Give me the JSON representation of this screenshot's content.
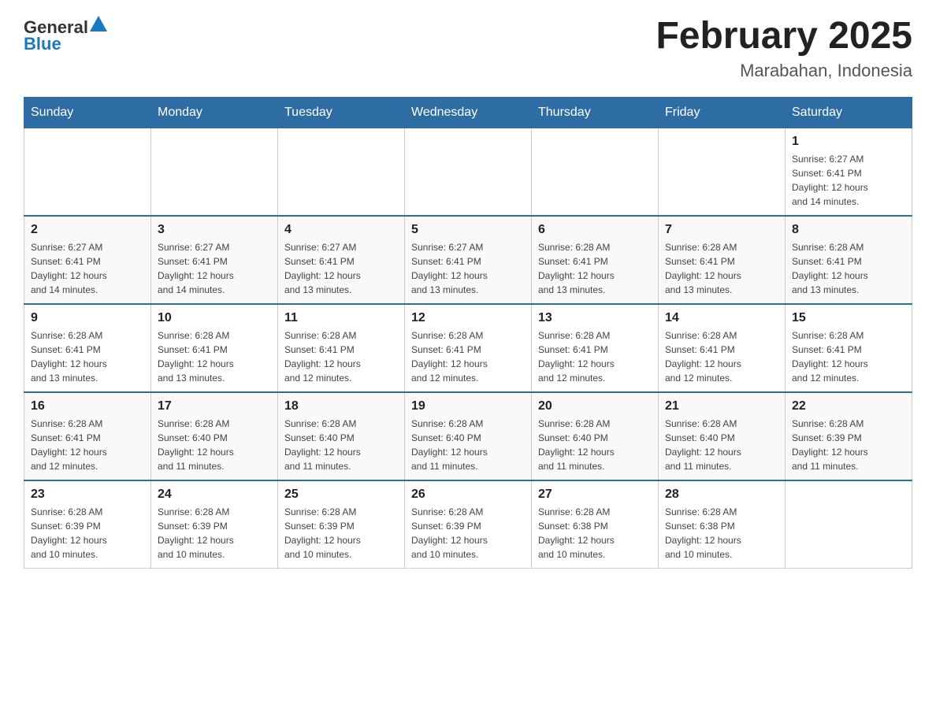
{
  "header": {
    "logo_general": "General",
    "logo_blue": "Blue",
    "title": "February 2025",
    "subtitle": "Marabahan, Indonesia"
  },
  "days_of_week": [
    "Sunday",
    "Monday",
    "Tuesday",
    "Wednesday",
    "Thursday",
    "Friday",
    "Saturday"
  ],
  "weeks": [
    [
      {
        "day": "",
        "info": ""
      },
      {
        "day": "",
        "info": ""
      },
      {
        "day": "",
        "info": ""
      },
      {
        "day": "",
        "info": ""
      },
      {
        "day": "",
        "info": ""
      },
      {
        "day": "",
        "info": ""
      },
      {
        "day": "1",
        "info": "Sunrise: 6:27 AM\nSunset: 6:41 PM\nDaylight: 12 hours\nand 14 minutes."
      }
    ],
    [
      {
        "day": "2",
        "info": "Sunrise: 6:27 AM\nSunset: 6:41 PM\nDaylight: 12 hours\nand 14 minutes."
      },
      {
        "day": "3",
        "info": "Sunrise: 6:27 AM\nSunset: 6:41 PM\nDaylight: 12 hours\nand 14 minutes."
      },
      {
        "day": "4",
        "info": "Sunrise: 6:27 AM\nSunset: 6:41 PM\nDaylight: 12 hours\nand 13 minutes."
      },
      {
        "day": "5",
        "info": "Sunrise: 6:27 AM\nSunset: 6:41 PM\nDaylight: 12 hours\nand 13 minutes."
      },
      {
        "day": "6",
        "info": "Sunrise: 6:28 AM\nSunset: 6:41 PM\nDaylight: 12 hours\nand 13 minutes."
      },
      {
        "day": "7",
        "info": "Sunrise: 6:28 AM\nSunset: 6:41 PM\nDaylight: 12 hours\nand 13 minutes."
      },
      {
        "day": "8",
        "info": "Sunrise: 6:28 AM\nSunset: 6:41 PM\nDaylight: 12 hours\nand 13 minutes."
      }
    ],
    [
      {
        "day": "9",
        "info": "Sunrise: 6:28 AM\nSunset: 6:41 PM\nDaylight: 12 hours\nand 13 minutes."
      },
      {
        "day": "10",
        "info": "Sunrise: 6:28 AM\nSunset: 6:41 PM\nDaylight: 12 hours\nand 13 minutes."
      },
      {
        "day": "11",
        "info": "Sunrise: 6:28 AM\nSunset: 6:41 PM\nDaylight: 12 hours\nand 12 minutes."
      },
      {
        "day": "12",
        "info": "Sunrise: 6:28 AM\nSunset: 6:41 PM\nDaylight: 12 hours\nand 12 minutes."
      },
      {
        "day": "13",
        "info": "Sunrise: 6:28 AM\nSunset: 6:41 PM\nDaylight: 12 hours\nand 12 minutes."
      },
      {
        "day": "14",
        "info": "Sunrise: 6:28 AM\nSunset: 6:41 PM\nDaylight: 12 hours\nand 12 minutes."
      },
      {
        "day": "15",
        "info": "Sunrise: 6:28 AM\nSunset: 6:41 PM\nDaylight: 12 hours\nand 12 minutes."
      }
    ],
    [
      {
        "day": "16",
        "info": "Sunrise: 6:28 AM\nSunset: 6:41 PM\nDaylight: 12 hours\nand 12 minutes."
      },
      {
        "day": "17",
        "info": "Sunrise: 6:28 AM\nSunset: 6:40 PM\nDaylight: 12 hours\nand 11 minutes."
      },
      {
        "day": "18",
        "info": "Sunrise: 6:28 AM\nSunset: 6:40 PM\nDaylight: 12 hours\nand 11 minutes."
      },
      {
        "day": "19",
        "info": "Sunrise: 6:28 AM\nSunset: 6:40 PM\nDaylight: 12 hours\nand 11 minutes."
      },
      {
        "day": "20",
        "info": "Sunrise: 6:28 AM\nSunset: 6:40 PM\nDaylight: 12 hours\nand 11 minutes."
      },
      {
        "day": "21",
        "info": "Sunrise: 6:28 AM\nSunset: 6:40 PM\nDaylight: 12 hours\nand 11 minutes."
      },
      {
        "day": "22",
        "info": "Sunrise: 6:28 AM\nSunset: 6:39 PM\nDaylight: 12 hours\nand 11 minutes."
      }
    ],
    [
      {
        "day": "23",
        "info": "Sunrise: 6:28 AM\nSunset: 6:39 PM\nDaylight: 12 hours\nand 10 minutes."
      },
      {
        "day": "24",
        "info": "Sunrise: 6:28 AM\nSunset: 6:39 PM\nDaylight: 12 hours\nand 10 minutes."
      },
      {
        "day": "25",
        "info": "Sunrise: 6:28 AM\nSunset: 6:39 PM\nDaylight: 12 hours\nand 10 minutes."
      },
      {
        "day": "26",
        "info": "Sunrise: 6:28 AM\nSunset: 6:39 PM\nDaylight: 12 hours\nand 10 minutes."
      },
      {
        "day": "27",
        "info": "Sunrise: 6:28 AM\nSunset: 6:38 PM\nDaylight: 12 hours\nand 10 minutes."
      },
      {
        "day": "28",
        "info": "Sunrise: 6:28 AM\nSunset: 6:38 PM\nDaylight: 12 hours\nand 10 minutes."
      },
      {
        "day": "",
        "info": ""
      }
    ]
  ]
}
